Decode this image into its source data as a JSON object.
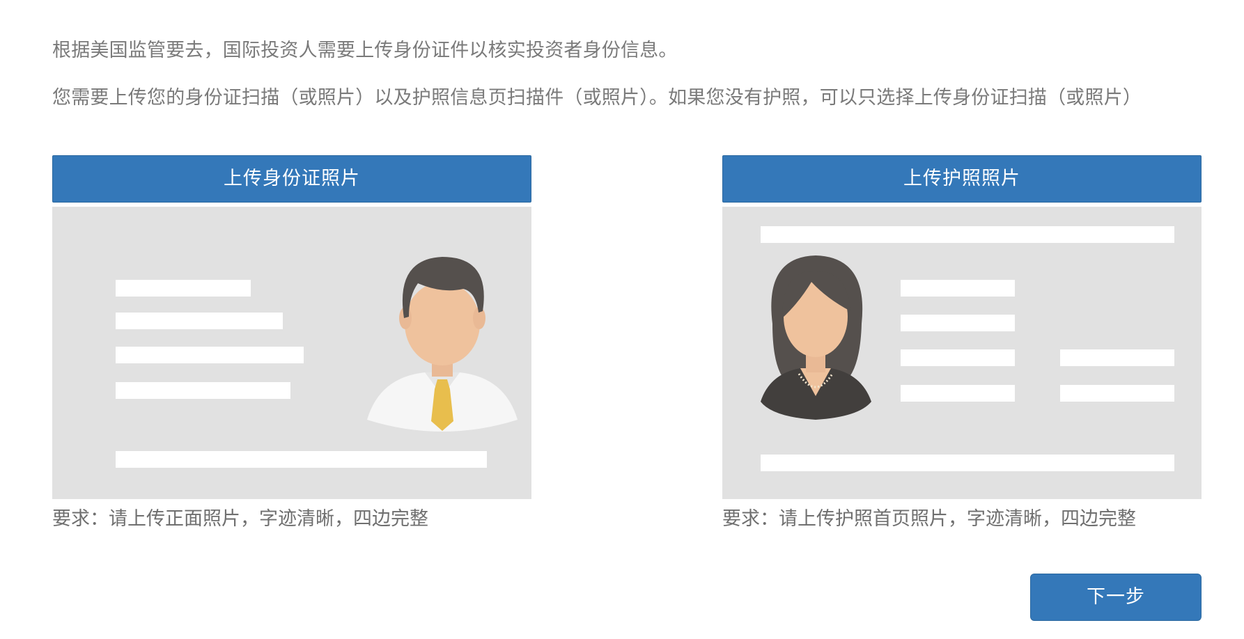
{
  "intro": {
    "line1": "根据美国监管要去，国际投资人需要上传身份证件以核实投资者身份信息。",
    "line2": "您需要上传您的身份证扫描（或照片）以及护照信息页扫描件（或照片）。如果您没有护照，可以只选择上传身份证扫描（或照片）"
  },
  "id_card": {
    "button_label": "上传身份证照片",
    "requirement": "要求：请上传正面照片，字迹清晰，四边完整",
    "illustration_icon": "id-card-male-avatar"
  },
  "passport": {
    "button_label": "上传护照照片",
    "requirement": "要求：请上传护照首页照片，字迹清晰，四边完整",
    "illustration_icon": "passport-female-avatar"
  },
  "next_button_label": "下一步",
  "colors": {
    "primary_button": "#3478b9",
    "placeholder_bg": "#e1e1e1",
    "text": "#7a7a7a"
  }
}
